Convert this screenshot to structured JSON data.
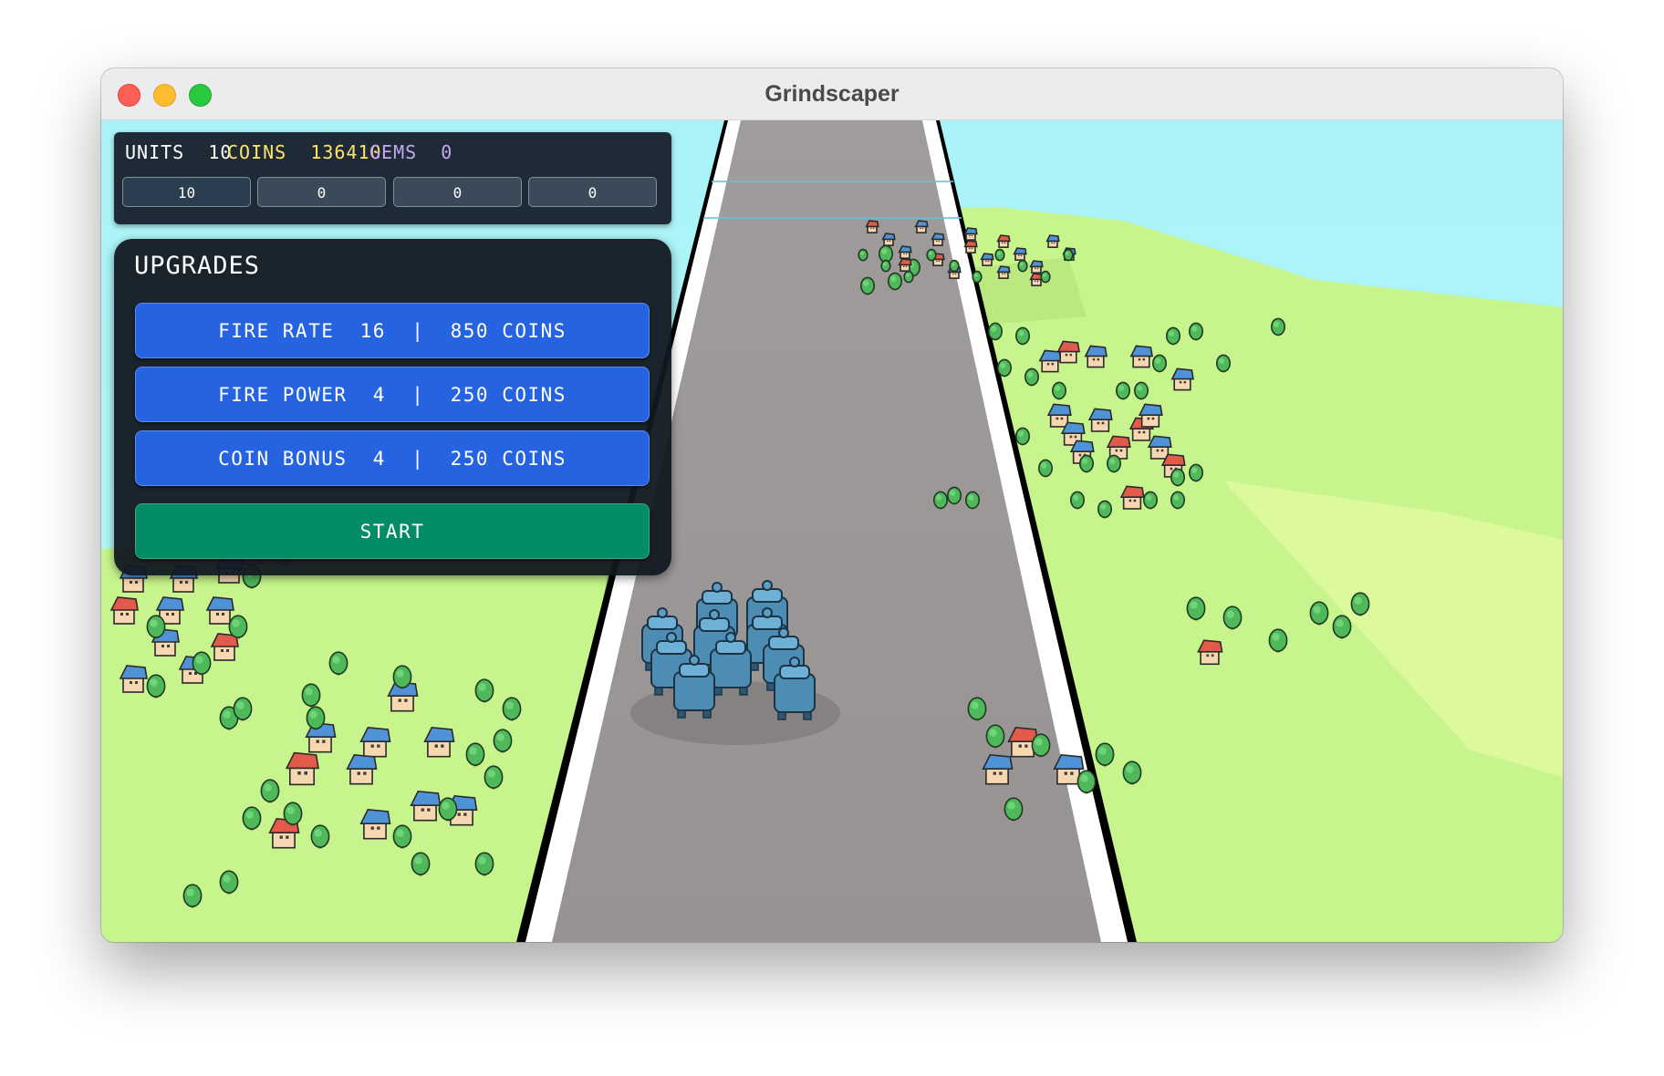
{
  "window": {
    "title": "Grindscaper"
  },
  "hud": {
    "units_label": "UNITS",
    "units_value": "10",
    "coins_label": "COINS",
    "coins_value": "136410",
    "gems_label": "GEMS",
    "gems_value": "0",
    "slots": [
      "10",
      "0",
      "0",
      "0"
    ]
  },
  "upgrades": {
    "title": "UPGRADES",
    "fire_rate": "FIRE RATE  16  |  850 COINS",
    "fire_power": "FIRE POWER  4  |  250 COINS",
    "coin_bonus": "COIN BONUS  4  |  250 COINS",
    "start": "START"
  },
  "colors": {
    "sky": "#aef5f8",
    "grass": "#c8f58a",
    "road": "#999595",
    "coins": "#ffe46b",
    "gems": "#c4a8f0",
    "upgrade_button": "#2563e0",
    "start_button": "#048c66"
  }
}
